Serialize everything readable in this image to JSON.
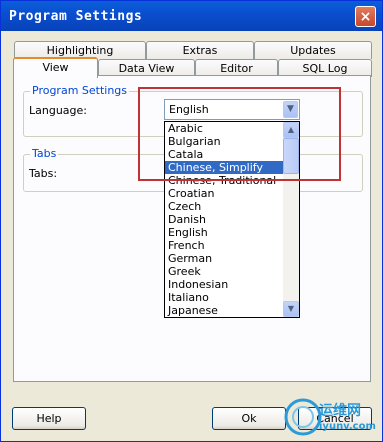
{
  "window": {
    "title": "Program Settings",
    "close_glyph": "×"
  },
  "tabs_back": [
    "Highlighting",
    "Extras",
    "Updates"
  ],
  "tabs_front": [
    "View",
    "Data View",
    "Editor",
    "SQL Log"
  ],
  "active_tab": "View",
  "program_settings": {
    "group_title": "Program Settings",
    "language_label": "Language:",
    "language_value": "English"
  },
  "language_options": [
    "Arabic",
    "Bulgarian",
    "Catala",
    "Chinese, Simplify",
    "Chinese, Traditional",
    "Croatian",
    "Czech",
    "Danish",
    "English",
    "French",
    "German",
    "Greek",
    "Indonesian",
    "Italiano",
    "Japanese"
  ],
  "selected_option": "Chinese, Simplify",
  "tabs_group": {
    "group_title": "Tabs",
    "tabs_label": "Tabs:"
  },
  "buttons": {
    "help": "Help",
    "ok": "Ok",
    "cancel": "Cancel"
  },
  "watermark": {
    "text": "运维网",
    "url": "iyunv.com"
  },
  "colors": {
    "highlight_box": "#c33232",
    "selection": "#316ac5",
    "titlebar": "#0a4fd0"
  }
}
